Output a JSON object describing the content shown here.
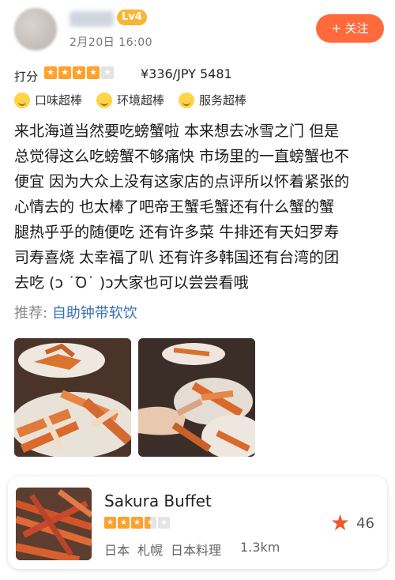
{
  "header": {
    "level_badge": "Lv4",
    "date": "2月20日 16:00",
    "follow_label": "+ 关注"
  },
  "rating": {
    "label": "打分",
    "stars": 4,
    "max_stars": 5,
    "price": "¥336/JPY 5481"
  },
  "tags": [
    "口味超棒",
    "环境超棒",
    "服务超棒"
  ],
  "body_lines": [
    "来北海道当然要吃螃蟹啦 本来想去冰雪之门 但是",
    "总觉得这么吃螃蟹不够痛快 市场里的一直螃蟹也不",
    "便宜 因为大众上没有这家店的点评所以怀着紧张的",
    "心情去的  也太棒了吧帝王蟹毛蟹还有什么蟹的蟹",
    "腿热乎乎的随便吃 还有许多菜 牛排还有天妇罗寿",
    "司寿喜烧 太幸福了叭 还有许多韩国还有台湾的团",
    "去吃 (ɔ ˙Ꝺ˙ )ɔ大家也可以尝尝看哦"
  ],
  "recommend": {
    "label": "推荐:",
    "items": "自助钟带软饮"
  },
  "shop": {
    "name": "Sakura Buffet",
    "stars": 3.5,
    "meta": [
      "日本",
      "札幌",
      "日本料理"
    ],
    "distance": "1.3km",
    "favorites": "46"
  },
  "colors": {
    "accent": "#ff6a3d",
    "star": "#ffa12b",
    "link": "#3a6fb5",
    "fav_star": "#f05a28"
  }
}
